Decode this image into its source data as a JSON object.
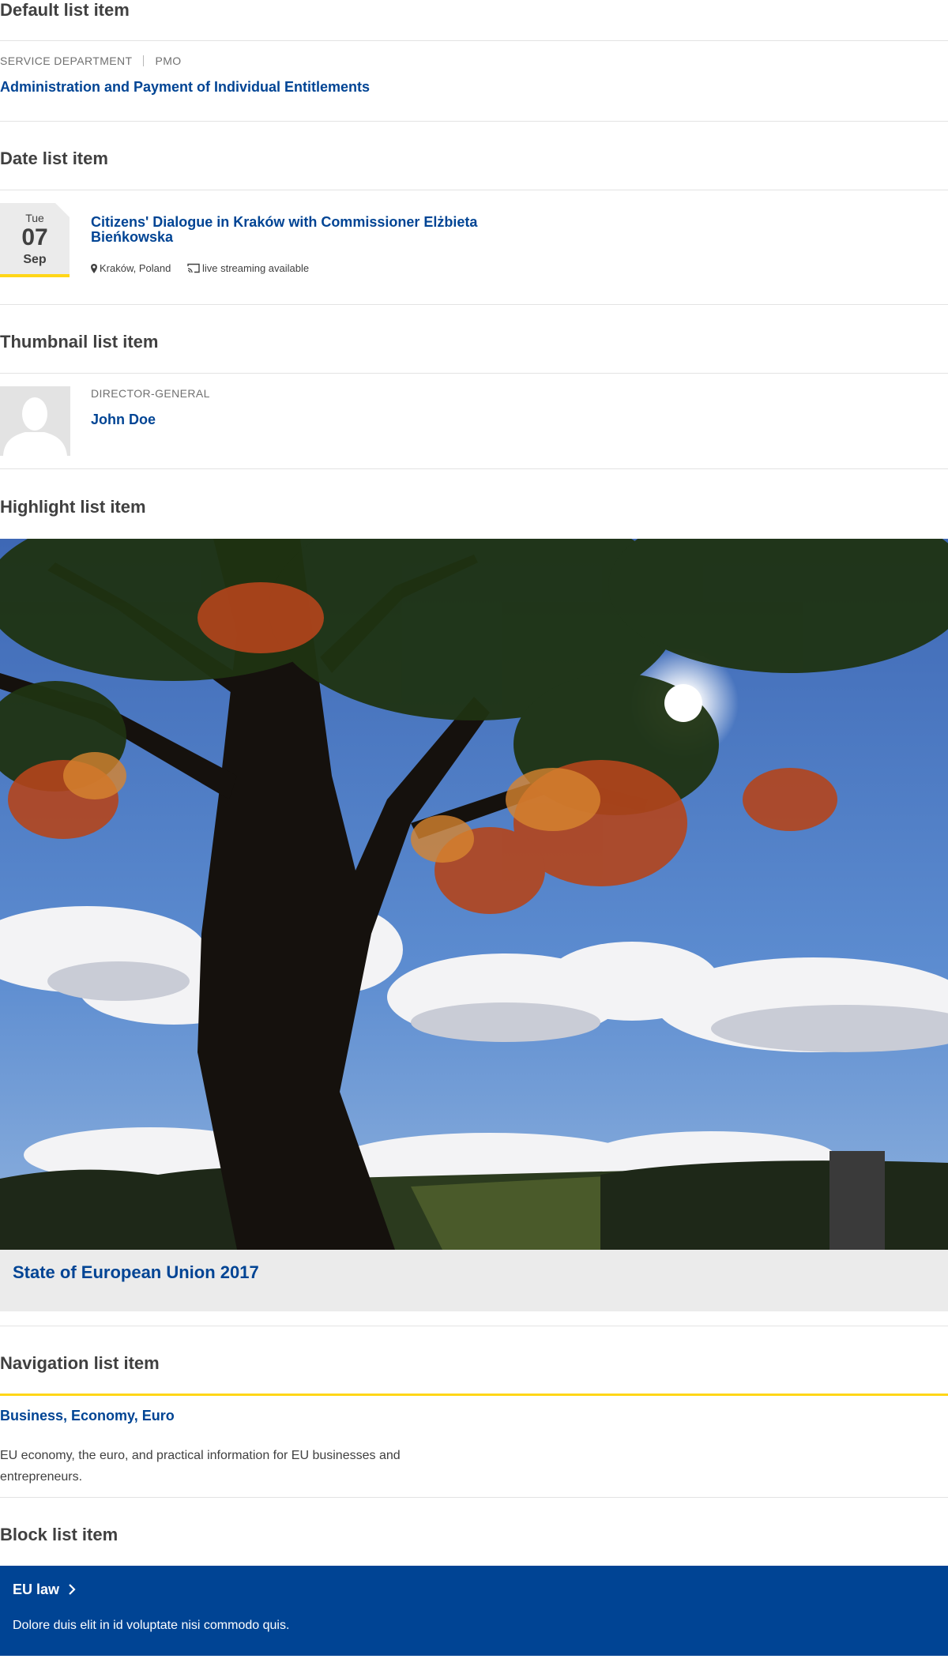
{
  "sections": {
    "default": {
      "title": "Default list item",
      "meta_1": "SERVICE DEPARTMENT",
      "meta_2": "PMO",
      "link": "Administration and Payment of Individual Entitlements"
    },
    "date": {
      "title": "Date list item",
      "day": "Tue",
      "date": "07",
      "month": "Sep",
      "link_line_1": "Citizens' Dialogue in Kraków with Commissioner Elżbieta",
      "link_line_2": "Bieńkowska",
      "location": "Kraków, Poland",
      "streaming": "live streaming available",
      "location_icon": "map-marker-icon",
      "streaming_icon": "cast-icon"
    },
    "thumbnail": {
      "title": "Thumbnail list item",
      "meta": "DIRECTOR-GENERAL",
      "link": "John Doe",
      "image_icon": "avatar-placeholder-icon"
    },
    "highlight": {
      "title": "Highlight list item",
      "link": "State of European Union 2017"
    },
    "navigation": {
      "title": "Navigation list item",
      "link": "Business, Economy, Euro",
      "description": "EU economy, the euro, and practical information for EU businesses and entrepreneurs."
    },
    "block": {
      "title": "Block list item",
      "link": "EU law",
      "description": "Dolore duis elit in id voluptate nisi commodo quis.",
      "link_icon": "chevron-right-icon"
    }
  },
  "colors": {
    "link": "#004494",
    "accent": "#ffd617",
    "heading": "#404040",
    "muted": "#707070",
    "divider": "#e3e3e3",
    "block_bg": "#004494",
    "caption_bg": "#ebebeb"
  }
}
